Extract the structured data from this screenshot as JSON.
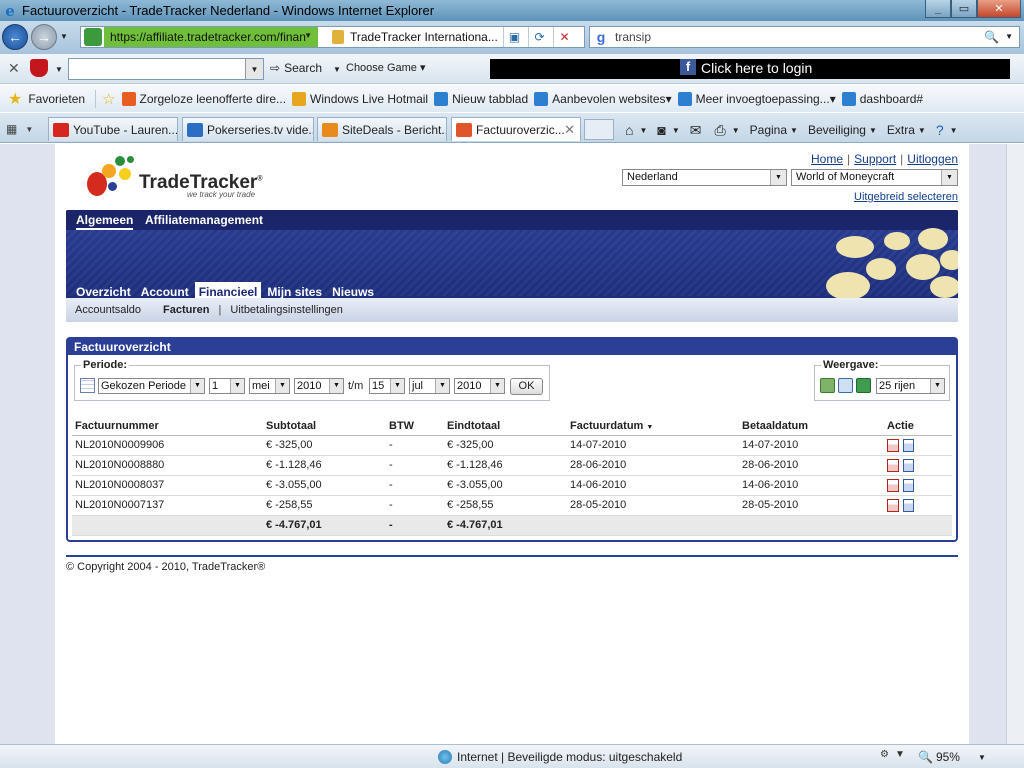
{
  "window": {
    "title": "Factuuroverzicht - TradeTracker Nederland - Windows Internet Explorer"
  },
  "address": {
    "url_secure": "https://",
    "url_host": "affiliate.tradetracker.com/finan",
    "cert_label": "TradeTracker Internationa...",
    "search_value": "transip"
  },
  "toolbar": {
    "search_label": "Search",
    "game_label": "Choose Game",
    "fb_login": "Click here to login"
  },
  "favorites": {
    "label": "Favorieten",
    "items": [
      {
        "label": "Zorgeloze leenofferte dire...",
        "color": "#e85d20"
      },
      {
        "label": "Windows Live Hotmail",
        "color": "#e6a71f"
      },
      {
        "label": "Nieuw tabblad",
        "color": "#2d7fd0"
      },
      {
        "label": "Aanbevolen websites",
        "color": "#2d7fd0"
      },
      {
        "label": "Meer invoegtoepassing...",
        "color": "#2d7fd0"
      },
      {
        "label": "dashboard#",
        "color": "#2d7fd0"
      }
    ]
  },
  "tabs": [
    {
      "label": "YouTube - Lauren...",
      "color": "#d6261e"
    },
    {
      "label": "Pokerseries.tv vide...",
      "color": "#2a6fc4"
    },
    {
      "label": "SiteDeals - Bericht...",
      "color": "#e88a1c"
    },
    {
      "label": "Factuuroverzic...",
      "color": "#e0552a"
    }
  ],
  "commands": {
    "page": "Pagina",
    "security": "Beveiliging",
    "extra": "Extra"
  },
  "site": {
    "brand": "TradeTracker",
    "registered": "®",
    "tagline": "we track your trade",
    "links": {
      "home": "Home",
      "support": "Support",
      "logout": "Uitloggen"
    },
    "country_select": "Nederland",
    "site_select": "World of Moneycraft",
    "advanced_link": "Uitgebreid selecteren",
    "top_tabs": {
      "general": "Algemeen",
      "affiliate": "Affiliatemanagement"
    },
    "main_nav": [
      "Overzicht",
      "Account",
      "Financieel",
      "Mijn sites",
      "Nieuws"
    ],
    "sub_nav": {
      "balance": "Accountsaldo",
      "invoices": "Facturen",
      "payout": "Uitbetalingsinstellingen",
      "sep": "|"
    }
  },
  "panel": {
    "title": "Factuuroverzicht",
    "period_label": "Periode:",
    "period_type": "Gekozen Periode",
    "from_day": "1",
    "from_month": "mei",
    "from_year": "2010",
    "until_label": "t/m",
    "to_day": "15",
    "to_month": "jul",
    "to_year": "2010",
    "ok_label": "OK",
    "view_label": "Weergave:",
    "rows_select": "25 rijen"
  },
  "table": {
    "headers": {
      "number": "Factuurnummer",
      "subtotal": "Subtotaal",
      "vat": "BTW",
      "total": "Eindtotaal",
      "invoice_date": "Factuurdatum",
      "payment_date": "Betaaldatum",
      "action": "Actie"
    },
    "rows": [
      {
        "number": "NL2010N0009906",
        "subtotal": "€ -325,00",
        "vat": "-",
        "total": "€ -325,00",
        "invoice_date": "14-07-2010",
        "payment_date": "14-07-2010"
      },
      {
        "number": "NL2010N0008880",
        "subtotal": "€ -1.128,46",
        "vat": "-",
        "total": "€ -1.128,46",
        "invoice_date": "28-06-2010",
        "payment_date": "28-06-2010"
      },
      {
        "number": "NL2010N0008037",
        "subtotal": "€ -3.055,00",
        "vat": "-",
        "total": "€ -3.055,00",
        "invoice_date": "14-06-2010",
        "payment_date": "14-06-2010"
      },
      {
        "number": "NL2010N0007137",
        "subtotal": "€ -258,55",
        "vat": "-",
        "total": "€ -258,55",
        "invoice_date": "28-05-2010",
        "payment_date": "28-05-2010"
      }
    ],
    "totals": {
      "subtotal": "€ -4.767,01",
      "vat": "-",
      "total": "€ -4.767,01"
    }
  },
  "footer": {
    "copyright": "© Copyright 2004 - 2010, TradeTracker®"
  },
  "status": {
    "zone": "Internet | Beveiligde modus: uitgeschakeld",
    "zoom": "95%"
  },
  "colors": {
    "brand_navy": "#2b3f96",
    "link_blue": "#153e8e"
  }
}
